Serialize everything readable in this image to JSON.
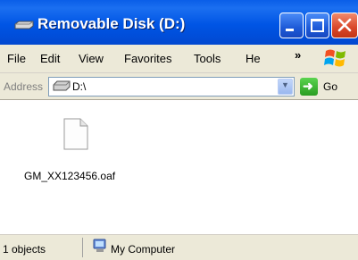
{
  "window": {
    "title": "Removable Disk (D:)"
  },
  "title_buttons": {
    "minimize_icon": "minimize-icon",
    "maximize_icon": "maximize-icon",
    "close_icon": "close-icon"
  },
  "menu": {
    "items": [
      "File",
      "Edit",
      "View",
      "Favorites",
      "Tools",
      "He"
    ],
    "overflow": "»"
  },
  "address": {
    "label": "Address",
    "value": "D:\\",
    "go_label": "Go"
  },
  "files": [
    {
      "name": "GM_XX123456.oaf",
      "icon": "blank-file-icon"
    }
  ],
  "status": {
    "count": "1 objects",
    "location": "My Computer"
  },
  "colors": {
    "titlebar": "#0055e5",
    "chrome": "#ece9d8",
    "close": "#d9472a",
    "go": "#2a9d22"
  }
}
